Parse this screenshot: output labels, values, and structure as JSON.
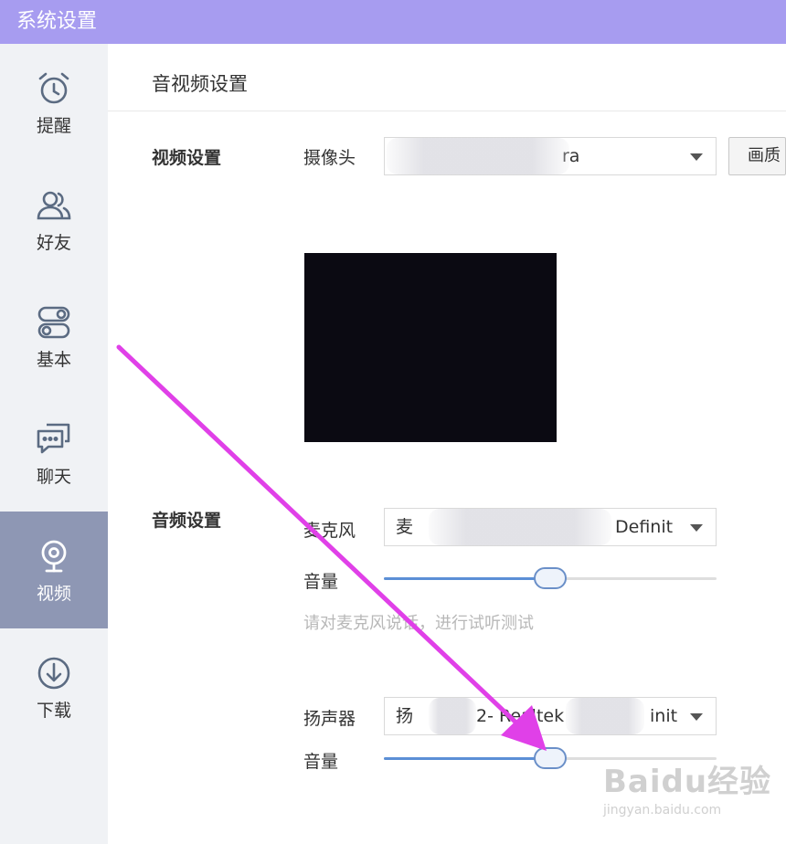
{
  "window": {
    "title": "系统设置"
  },
  "sidebar": {
    "items": [
      {
        "label": "提醒",
        "icon": "alarm-clock-icon",
        "active": false
      },
      {
        "label": "好友",
        "icon": "friends-icon",
        "active": false
      },
      {
        "label": "基本",
        "icon": "toggle-switches-icon",
        "active": false
      },
      {
        "label": "聊天",
        "icon": "chat-bubbles-icon",
        "active": false
      },
      {
        "label": "视频",
        "icon": "webcam-icon",
        "active": true
      },
      {
        "label": "下载",
        "icon": "download-icon",
        "active": false
      }
    ]
  },
  "main": {
    "title": "音视频设置",
    "video": {
      "section_label": "视频设置",
      "camera_label": "摄像头",
      "camera_value": "ra",
      "quality_button": "画质"
    },
    "audio": {
      "section_label": "音频设置",
      "mic_label": "麦克风",
      "mic_value_start": "麦",
      "mic_value_end": "Definit",
      "mic_volume_label": "音量",
      "mic_volume": 0.5,
      "hint": "请对麦克风说话，进行试听测试",
      "speaker_label": "扬声器",
      "speaker_value_start": "扬",
      "speaker_value_mid": "2- Realtek",
      "speaker_value_end": "init",
      "speaker_volume_label": "音量",
      "speaker_volume": 0.5
    }
  },
  "watermark": {
    "brand": "Baidu经验",
    "url": "jingyan.baidu.com"
  },
  "colors": {
    "titlebar": "#a79cf0",
    "sidebar_bg": "#f0f2f5",
    "sidebar_active": "#8e97b4",
    "slider_fill": "#5b8fd6",
    "arrow": "#e040e8"
  }
}
